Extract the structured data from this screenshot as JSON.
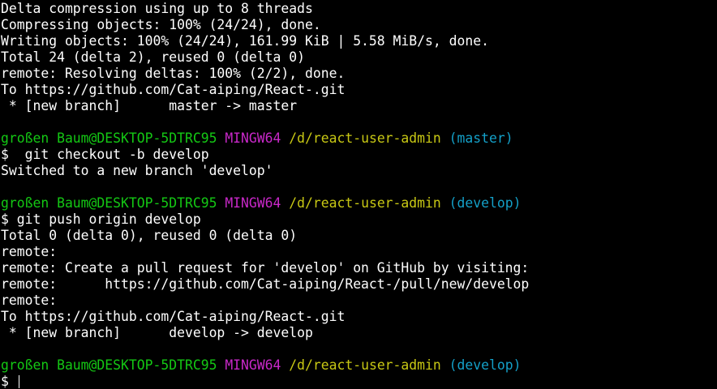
{
  "output1": [
    "Delta compression using up to 8 threads",
    "Compressing objects: 100% (24/24), done.",
    "Writing objects: 100% (24/24), 161.99 KiB | 5.58 MiB/s, done.",
    "Total 24 (delta 2), reused 0 (delta 0)",
    "remote: Resolving deltas: 100% (2/2), done.",
    "To https://github.com/Cat-aiping/React-.git",
    " * [new branch]      master -> master"
  ],
  "prompts": [
    {
      "user": "großen Baum@DESKTOP-5DTRC95",
      "system": "MINGW64",
      "path": "/d/react-user-admin",
      "branch": "(master)"
    },
    {
      "user": "großen Baum@DESKTOP-5DTRC95",
      "system": "MINGW64",
      "path": "/d/react-user-admin",
      "branch": "(develop)"
    },
    {
      "user": "großen Baum@DESKTOP-5DTRC95",
      "system": "MINGW64",
      "path": "/d/react-user-admin",
      "branch": "(develop)"
    }
  ],
  "commands": [
    "$  git checkout -b develop",
    "$ git push origin develop",
    "$"
  ],
  "output2": [
    "Switched to a new branch 'develop'"
  ],
  "output3": [
    "Total 0 (delta 0), reused 0 (delta 0)",
    "remote:",
    "remote: Create a pull request for 'develop' on GitHub by visiting:",
    "remote:      https://github.com/Cat-aiping/React-/pull/new/develop",
    "remote:",
    "To https://github.com/Cat-aiping/React-.git",
    " * [new branch]      develop -> develop"
  ],
  "colors": {
    "background": "#000000",
    "text": "#ffffff",
    "user": "#14c814",
    "system": "#c828c8",
    "path": "#c8c814",
    "branch": "#14a0c8"
  }
}
